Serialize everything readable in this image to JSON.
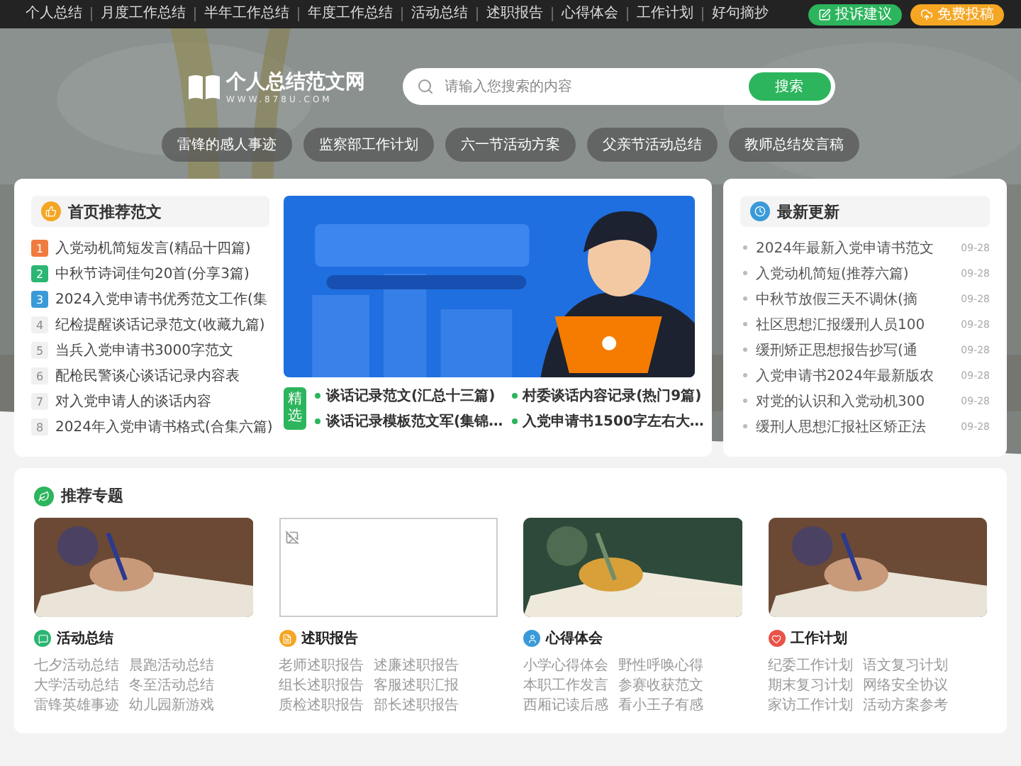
{
  "top_nav": {
    "links": [
      "个人总结",
      "月度工作总结",
      "半年工作总结",
      "年度工作总结",
      "活动总结",
      "述职报告",
      "心得体会",
      "工作计划",
      "好句摘抄"
    ],
    "buttons": [
      {
        "label": "投诉建议",
        "kind": "feedback",
        "color": "#2db55d"
      },
      {
        "label": "免费投稿",
        "kind": "submit",
        "color": "#f5a623"
      }
    ]
  },
  "logo": {
    "name": "个人总结范文网",
    "domain": "WWW.878U.COM"
  },
  "search": {
    "placeholder": "请输入您搜索的内容",
    "button": "搜索"
  },
  "hot_tags": [
    "雷锋的感人事迹",
    "监察部工作计划",
    "六一节活动方案",
    "父亲节活动总结",
    "教师总结发言稿"
  ],
  "recommended": {
    "title": "首页推荐范文",
    "items": [
      {
        "rank": "1",
        "title": "入党动机简短发言(精品十四篇)",
        "color": "#f07b3f"
      },
      {
        "rank": "2",
        "title": "中秋节诗词佳句20首(分享3篇)",
        "color": "#2bb673"
      },
      {
        "rank": "3",
        "title": "2024入党申请书优秀范文工作(集",
        "color": "#3a9ad9"
      },
      {
        "rank": "4",
        "title": "纪检提醒谈话记录范文(收藏九篇)",
        "color": "#f0f0f0"
      },
      {
        "rank": "5",
        "title": "当兵入党申请书3000字范文",
        "color": "#f0f0f0"
      },
      {
        "rank": "6",
        "title": "配枪民警谈心谈话记录内容表",
        "color": "#f0f0f0"
      },
      {
        "rank": "7",
        "title": "对入党申请人的谈话内容",
        "color": "#f0f0f0"
      },
      {
        "rank": "8",
        "title": "2024年入党申请书格式(合集六篇)",
        "color": "#f0f0f0"
      }
    ]
  },
  "featured": {
    "badge": "精选",
    "links": [
      "谈话记录范文(汇总十三篇)",
      "村委谈话内容记录(热门9篇)",
      "谈话记录模板范文军(集锦…",
      "入党申请书1500字左右大…"
    ]
  },
  "latest": {
    "title": "最新更新",
    "items": [
      {
        "title": "2024年最新入党申请书范文",
        "date": "09-28"
      },
      {
        "title": "入党动机简短(推荐六篇)",
        "date": "09-28"
      },
      {
        "title": "中秋节放假三天不调休(摘",
        "date": "09-28"
      },
      {
        "title": "社区思想汇报缓刑人员100",
        "date": "09-28"
      },
      {
        "title": "缓刑矫正思想报告抄写(通",
        "date": "09-28"
      },
      {
        "title": "入党申请书2024年最新版农",
        "date": "09-28"
      },
      {
        "title": "对党的认识和入党动机300",
        "date": "09-28"
      },
      {
        "title": "缓刑人思想汇报社区矫正法",
        "date": "09-28"
      }
    ]
  },
  "topics": {
    "title": "推荐专题",
    "items": [
      {
        "broken_image": false,
        "title": "活动总结",
        "color": "#2bb673",
        "kind": "chat",
        "links": [
          "七夕活动总结",
          "晨跑活动总结",
          "大学活动总结",
          "冬至活动总结",
          "雷锋英雄事迹",
          "幼儿园新游戏"
        ]
      },
      {
        "broken_image": true,
        "title": "述职报告",
        "color": "#f5a623",
        "kind": "document",
        "links": [
          "老师述职报告",
          "述廉述职报告",
          "组长述职报告",
          "客服述职汇报",
          "质检述职报告",
          "部长述职报告"
        ]
      },
      {
        "broken_image": false,
        "title": "心得体会",
        "color": "#3a9ad9",
        "kind": "person",
        "links": [
          "小学心得体会",
          "野性呼唤心得",
          "本职工作发言",
          "参赛收获范文",
          "西厢记读后感",
          "看小王子有感"
        ]
      },
      {
        "broken_image": false,
        "title": "工作计划",
        "color": "#e8534a",
        "kind": "heart",
        "links": [
          "纪委工作计划",
          "语文复习计划",
          "期末复习计划",
          "网络安全协议",
          "家访工作计划",
          "活动方案参考"
        ]
      }
    ]
  }
}
